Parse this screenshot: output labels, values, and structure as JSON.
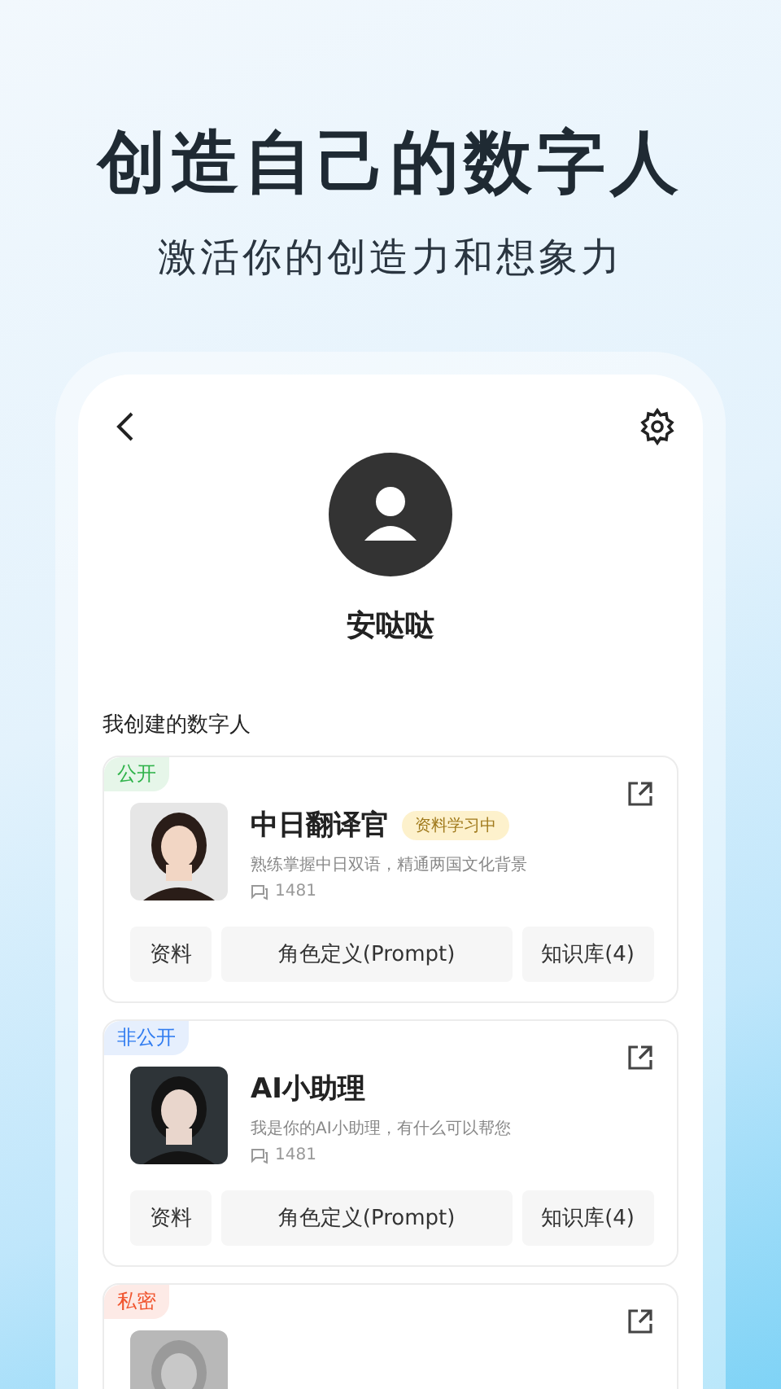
{
  "headline": "创造自己的数字人",
  "subheadline": "激活你的创造力和想象力",
  "profile": {
    "name": "安哒哒"
  },
  "section_title": "我创建的数字人",
  "cards": [
    {
      "tag": {
        "label": "公开",
        "color": "#2fb34a"
      },
      "name": "中日翻译官",
      "status": "资料学习中",
      "description": "熟练掌握中日双语，精通两国文化背景",
      "count": "1481",
      "buttons": [
        "资料",
        "角色定义(Prompt)",
        "知识库(4)"
      ]
    },
    {
      "tag": {
        "label": "非公开",
        "color": "#2f7bf0"
      },
      "name": "AI小助理",
      "description": "我是你的AI小助理，有什么可以帮您",
      "count": "1481",
      "buttons": [
        "资料",
        "角色定义(Prompt)",
        "知识库(4)"
      ]
    },
    {
      "tag": {
        "label": "私密",
        "color": "#f0552f"
      }
    }
  ]
}
